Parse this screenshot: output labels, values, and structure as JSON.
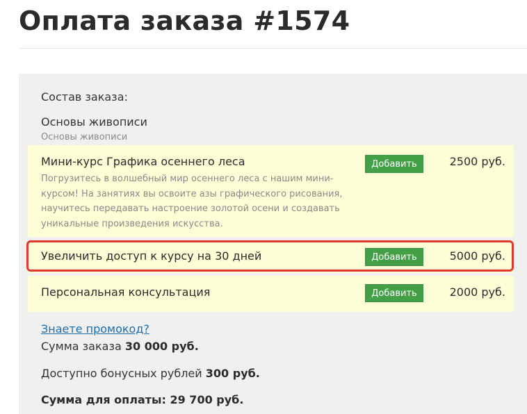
{
  "header": {
    "title": "Оплата заказа #1574"
  },
  "order": {
    "section_label": "Состав заказа:",
    "product_name": "Основы живописи",
    "product_subtitle": "Основы живописи"
  },
  "upsells": [
    {
      "name": "Мини-курс Графика осеннего леса",
      "description": "Погрузитесь в волшебный мир осеннего леса с нашим мини-курсом! На занятиях вы освоите азы графического рисования, научитесь передавать настроение золотой осени и создавать уникальные произведения искусства.",
      "button_label": "Добавить",
      "price": "2500 руб.",
      "highlighted": false
    },
    {
      "name": "Увеличить доступ к курсу на 30 дней",
      "description": "",
      "button_label": "Добавить",
      "price": "5000 руб.",
      "highlighted": true
    },
    {
      "name": "Персональная консультация",
      "description": "",
      "button_label": "Добавить",
      "price": "2000 руб.",
      "highlighted": false
    }
  ],
  "promo": {
    "link_label": "Знаете промокод?"
  },
  "summary": {
    "order_sum_label": "Сумма заказа",
    "order_sum_value": "30 000 руб.",
    "bonus_label": "Доступно бонусных рублей",
    "bonus_value": "300 руб.",
    "to_pay_label": "Сумма для оплаты:",
    "to_pay_value": "29 700 руб."
  },
  "colors": {
    "accent_button": "#43a047",
    "upsell_background": "#fdfdd6",
    "panel_background": "#f0f0f0",
    "highlight_border": "#e03a2f",
    "link": "#1a6db3"
  }
}
